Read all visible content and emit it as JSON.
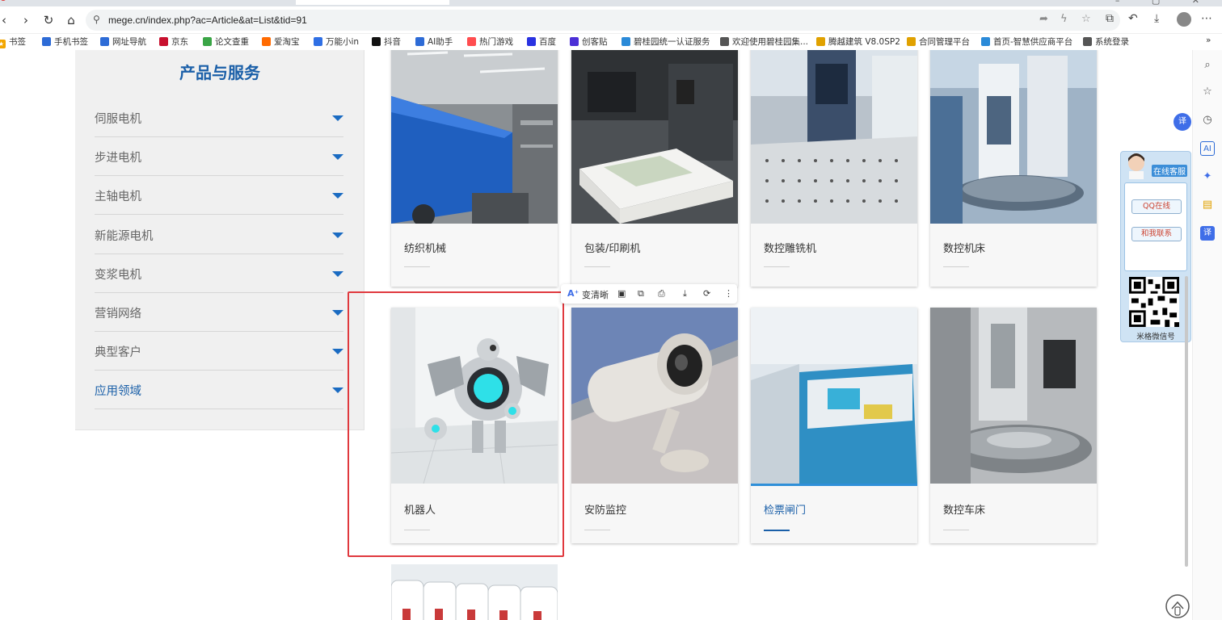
{
  "browser": {
    "url": "mege.cn/index.php?ac=Article&at=List&tid=91",
    "bookmarks": [
      "书签",
      "手机书签",
      "网址导航",
      "京东",
      "论文查重",
      "爱淘宝",
      "万能小in",
      "抖音",
      "AI助手",
      "热门游戏",
      "百度",
      "创客贴",
      "碧桂园统一认证服务",
      "欢迎使用碧桂园集...",
      "腾越建筑 V8.0SP2",
      "合同管理平台",
      "首页-智慧供应商平台",
      "系统登录"
    ],
    "bookmark_colors": [
      "#f3a600",
      "#2d6bd6",
      "#2d6bd6",
      "#c8102e",
      "#3aa546",
      "#ff6a00",
      "#2f6fe4",
      "#111111",
      "#2d6bd6",
      "#ff4d4f",
      "#2932e1",
      "#4b2fd6",
      "#2a8ad8",
      "#555555",
      "#e0a100",
      "#e0a100",
      "#2a8ad8",
      "#555555"
    ],
    "more_label": "»"
  },
  "sidebar": {
    "title": "产品与服务",
    "items": [
      {
        "label": "伺服电机"
      },
      {
        "label": "步进电机"
      },
      {
        "label": "主轴电机"
      },
      {
        "label": "新能源电机"
      },
      {
        "label": "变浆电机"
      },
      {
        "label": "营销网络"
      },
      {
        "label": "典型客户"
      },
      {
        "label": "应用领域"
      }
    ],
    "active_item": "应用领域"
  },
  "cards": [
    {
      "label": "纺织机械"
    },
    {
      "label": "包装/印刷机"
    },
    {
      "label": "数控雕铣机"
    },
    {
      "label": "数控机床"
    },
    {
      "label": "机器人"
    },
    {
      "label": "安防监控"
    },
    {
      "label": "检票闸门"
    },
    {
      "label": "数控车床"
    }
  ],
  "highlighted_card": "检票闸门",
  "image_toolbar": {
    "enhance": "变清晰",
    "buttons": [
      "ocr-icon",
      "edit-image-icon",
      "print-icon",
      "download-icon",
      "search-image-icon",
      "more-icon"
    ]
  },
  "service_float": {
    "title": "在线客服",
    "qq_button": "QQ在线",
    "contact_button": "和我联系",
    "qr_label": "米格微信号"
  },
  "translate_badge": "译",
  "side_panel_icons": [
    "search-icon",
    "star-icon",
    "history-icon",
    "ai-icon",
    "game-icon",
    "toolbox-icon",
    "translate-icon"
  ],
  "colors": {
    "brand_blue": "#1a5fa8",
    "highlight_box": "#e0393e",
    "sidebar_bg": "#f0f0f0"
  }
}
